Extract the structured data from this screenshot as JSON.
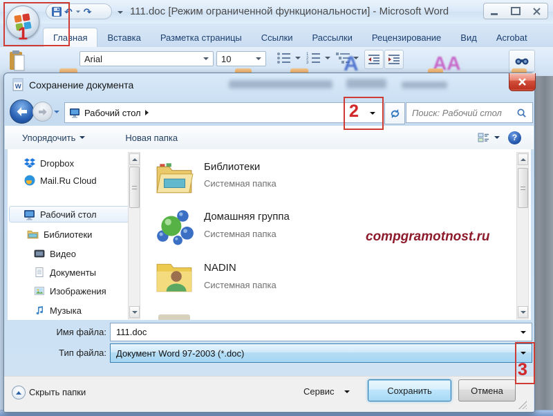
{
  "word": {
    "title": "111.doc [Режим ограниченной функциональности] - Microsoft Word",
    "tabs": [
      "Главная",
      "Вставка",
      "Разметка страницы",
      "Ссылки",
      "Рассылки",
      "Рецензирование",
      "Вид",
      "Acrobat"
    ],
    "active_tab": "Главная",
    "font_name": "Arial",
    "font_size": "10"
  },
  "dialog": {
    "title": "Сохранение документа",
    "nav": {
      "location": "Рабочий стол",
      "search_placeholder": "Поиск: Рабочий стол"
    },
    "commandbar": {
      "organize": "Упорядочить",
      "new_folder": "Новая папка"
    },
    "sidebar": {
      "items": [
        {
          "label": "Dropbox",
          "icon": "dropbox-icon"
        },
        {
          "label": "Mail.Ru Cloud",
          "icon": "mailru-cloud-icon"
        },
        {
          "label": "Рабочий стол",
          "icon": "desktop-icon",
          "selected": true
        },
        {
          "label": "Библиотеки",
          "icon": "libraries-icon"
        },
        {
          "label": "Видео",
          "icon": "videos-icon"
        },
        {
          "label": "Документы",
          "icon": "documents-icon"
        },
        {
          "label": "Изображения",
          "icon": "pictures-icon"
        },
        {
          "label": "Музыка",
          "icon": "music-icon"
        }
      ]
    },
    "files": [
      {
        "name": "Библиотеки",
        "type": "Системная папка",
        "icon": "libraries-folder-icon"
      },
      {
        "name": "Домашняя группа",
        "type": "Системная папка",
        "icon": "homegroup-icon"
      },
      {
        "name": "NADIN",
        "type": "Системная папка",
        "icon": "user-folder-icon"
      }
    ],
    "watermark": "compgramotnost.ru",
    "fields": {
      "file_name_label": "Имя файла:",
      "file_name_value": "111.doc",
      "file_type_label": "Тип файла:",
      "file_type_value": "Документ Word 97-2003 (*.doc)"
    },
    "footer": {
      "hide_folders": "Скрыть папки",
      "tools": "Сервис",
      "save": "Сохранить",
      "cancel": "Отмена"
    }
  },
  "annotations": {
    "step1": "1",
    "step2": "2",
    "step3": "3"
  },
  "colors": {
    "annotation_red": "#d22728",
    "watermark_red": "#8e1b2c",
    "selected_type_fill": "#b5ddf5",
    "default_button_border": "#3c7fb1"
  }
}
